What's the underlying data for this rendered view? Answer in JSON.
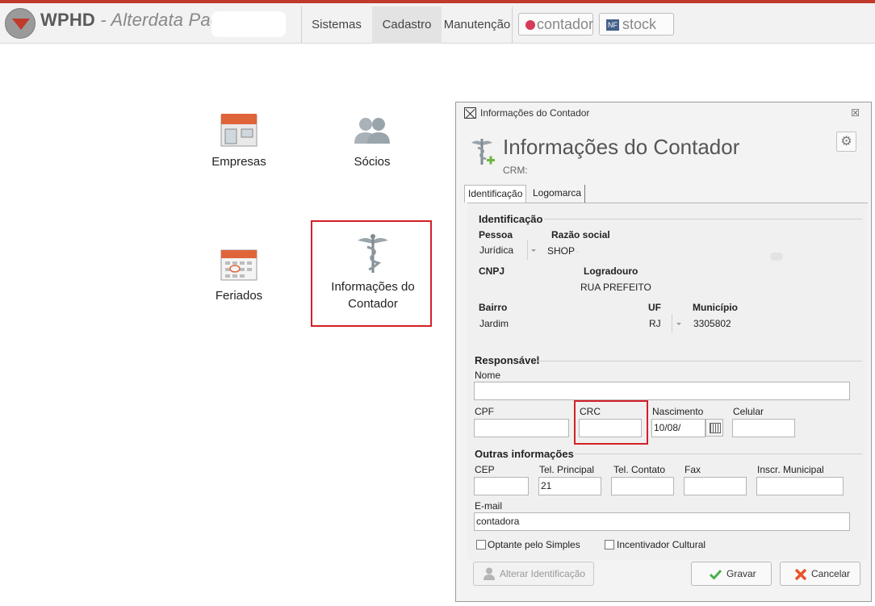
{
  "app": {
    "logo_bold": "WPHD",
    "logo_rest": " - Alterdata Pack"
  },
  "topnav": {
    "items": [
      "Sistemas",
      "Cadastro",
      "Manutenção"
    ],
    "active": "Cadastro",
    "contador_label": "contador",
    "stock_label": "stock",
    "stock_badge": "NF"
  },
  "tiles": {
    "empresas": "Empresas",
    "socios": "Sócios",
    "feriados": "Feriados",
    "informacoes_line1": "Informações do",
    "informacoes_line2": "Contador"
  },
  "dialog": {
    "window_title": "Informações do Contador",
    "close_glyph": "☒",
    "heading": "Informações do Contador",
    "crm_label": "CRM:",
    "gear_glyph": "⚙",
    "tabs": [
      "Identificação",
      "Logomarca"
    ],
    "identificacao": {
      "section": "Identificação",
      "pessoa_label": "Pessoa",
      "pessoa_value": "Jurídica",
      "razao_label": "Razão social",
      "razao_value": "SHOP -",
      "cnpj_label": "CNPJ",
      "logradouro_label": "Logradouro",
      "logradouro_value": "RUA PREFEITO",
      "bairro_label": "Bairro",
      "bairro_value": "Jardim",
      "uf_label": "UF",
      "uf_value": "RJ",
      "municipio_label": "Município",
      "municipio_value": "3305802"
    },
    "responsavel": {
      "section": "Responsável",
      "nome_label": "Nome",
      "nome_value": "",
      "cpf_label": "CPF",
      "cpf_value": "",
      "crc_label": "CRC",
      "crc_value": "",
      "nascimento_label": "Nascimento",
      "nascimento_value": "10/08/",
      "celular_label": "Celular",
      "celular_value": ""
    },
    "outras": {
      "section": "Outras informações",
      "cep_label": "CEP",
      "cep_value": "",
      "tel_principal_label": "Tel. Principal",
      "tel_principal_value": "21",
      "tel_contato_label": "Tel. Contato",
      "tel_contato_value": "",
      "fax_label": "Fax",
      "fax_value": "",
      "inscr_label": "Inscr. Municipal",
      "inscr_value": "",
      "email_label": "E-mail",
      "email_value": "contadora",
      "optante_label": "Optante pelo Simples",
      "optante_checked": false,
      "incentivador_label": "Incentivador Cultural",
      "incentivador_checked": false
    },
    "buttons": {
      "alterar": "Alterar Identificação",
      "gravar": "Gravar",
      "cancelar": "Cancelar"
    }
  },
  "colors": {
    "accent_red": "#d32027",
    "brand_red": "#c0392b",
    "gravar_check": "#4caf50",
    "cancel_x": "#e8532b"
  }
}
